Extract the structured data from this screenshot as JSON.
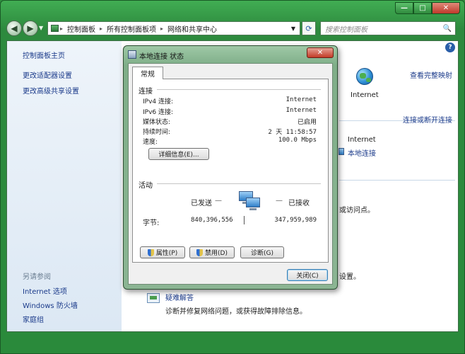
{
  "window": {
    "caption_buttons": {
      "min": "—",
      "max": "□",
      "close": "✕"
    },
    "nav": {
      "back": "◀",
      "forward": "▶",
      "dropdown": "▼"
    },
    "address": {
      "icon": "control-panel-icon",
      "segments": [
        "控制面板",
        "所有控制面板项",
        "网络和共享中心"
      ],
      "separator": "▸",
      "dropdown": "▼",
      "refresh": "⟳"
    },
    "search": {
      "placeholder": "搜索控制面板",
      "icon": "🔍"
    }
  },
  "sidebar": {
    "links_top": [
      "控制面板主页",
      "更改适配器设置",
      "更改高级共享设置"
    ],
    "see_also_heading": "另请参阅",
    "links_bottom": [
      "Internet 选项",
      "Windows 防火墙",
      "家庭组"
    ]
  },
  "main": {
    "help": "?",
    "view_full_map": "查看完整映射",
    "internet_label": "Internet",
    "connect_disconnect": "连接或断开连接",
    "access_type_value": "Internet",
    "connection_link": "本地连接",
    "partial_text_1": "或访问点。",
    "partial_text_2": "设置。",
    "troubleshoot_title": "疑难解答",
    "troubleshoot_desc": "诊断并修复网络问题，或获得故障排除信息。"
  },
  "dialog": {
    "title": "本地连接 状态",
    "close": "✕",
    "tab_general": "常规",
    "connection_heading": "连接",
    "rows": [
      {
        "label": "IPv4 连接:",
        "value": "Internet"
      },
      {
        "label": "IPv6 连接:",
        "value": "Internet"
      },
      {
        "label": "媒体状态:",
        "value": "已启用"
      },
      {
        "label": "持续时间:",
        "value": "2 天 11:58:57"
      },
      {
        "label": "速度:",
        "value": "100.0 Mbps"
      }
    ],
    "details_button": "详细信息(E)...",
    "activity_heading": "活动",
    "sent_label": "已发送",
    "received_label": "已接收",
    "bytes_label": "字节:",
    "bytes_sent": "840,396,556",
    "bytes_received": "347,959,989",
    "properties_button": "属性(P)",
    "disable_button": "禁用(D)",
    "diagnose_button": "诊断(G)",
    "close_button": "关闭(C)"
  }
}
